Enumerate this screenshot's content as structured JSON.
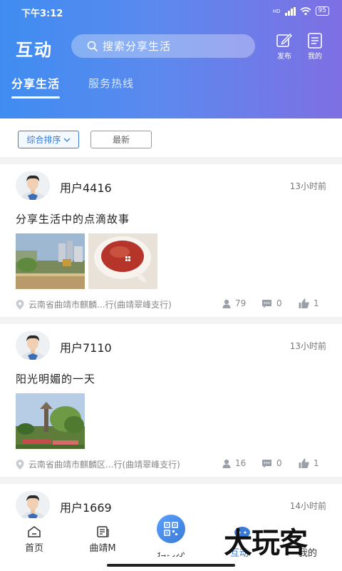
{
  "status_bar": {
    "time": "下午3:12",
    "network": "HD",
    "battery": "95"
  },
  "header": {
    "title": "互动",
    "search_placeholder": "搜索分享生活",
    "publish_label": "发布",
    "mine_label": "我的",
    "tabs": [
      {
        "label": "分享生活",
        "active": true
      },
      {
        "label": "服务热线",
        "active": false
      }
    ]
  },
  "sort": {
    "options": [
      "综合排序",
      "最新"
    ],
    "selected": "综合排序"
  },
  "posts": [
    {
      "user": "用户4416",
      "time": "13小时前",
      "title": "分享生活中的点滴故事",
      "image_count": 2,
      "location": "云南省曲靖市麒麟...行(曲靖翠峰支行)",
      "views": "79",
      "comments": "0",
      "likes": "1"
    },
    {
      "user": "用户7110",
      "time": "13小时前",
      "title": "阳光明媚的一天",
      "image_count": 1,
      "location": "云南省曲靖市麒麟区...行(曲靖翠峰支行)",
      "views": "16",
      "comments": "0",
      "likes": "1"
    },
    {
      "user": "用户1669",
      "time": "14小时前"
    }
  ],
  "bottom_nav": {
    "items": [
      {
        "label": "首页",
        "icon": "home-icon"
      },
      {
        "label": "曲靖M",
        "icon": "news-icon"
      },
      {
        "label": "扫码办",
        "icon": "qr-scan-icon"
      },
      {
        "label": "互动",
        "icon": "interact-icon",
        "active": true
      },
      {
        "label": "我的",
        "icon": "user-icon"
      }
    ]
  },
  "watermark": "大玩客",
  "colors": {
    "accent": "#3a7bd5",
    "header_start": "#3f8cf1",
    "header_end": "#7e6fe3"
  }
}
